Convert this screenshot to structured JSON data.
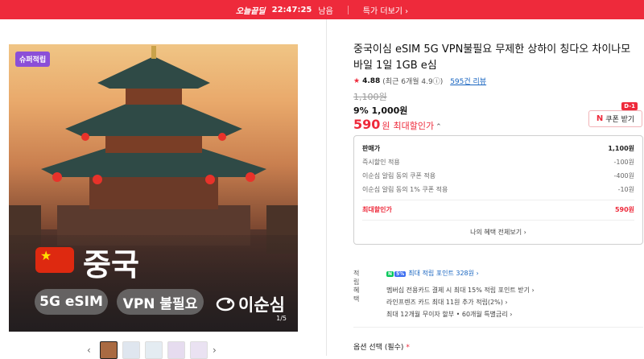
{
  "topbar": {
    "brand": "오늘끝딜",
    "timer": "22:47:25",
    "timer_suffix": "남음",
    "more": "특가 더보기 ›"
  },
  "hero": {
    "badge": "슈퍼적립",
    "country": "중국",
    "pill1": "5G eSIM",
    "pill2": "VPN 불필요",
    "logo": "이순심",
    "counter": "1/5"
  },
  "product": {
    "title": "중국이심 eSIM 5G VPN불필요 무제한 상하이 칭다오 차이나모바일 1일 1GB e심",
    "rating_score": "4.88",
    "rating_detail": "(최근 6개월 4.9ⓘ)",
    "review_link": "595건 리뷰",
    "original_price": "1,100원",
    "sale_price": "9% 1,000원",
    "final_num": "590",
    "final_unit": "원",
    "final_label": "최대할인가",
    "final_chev": "⌃"
  },
  "coupon": {
    "tag": "D-1",
    "icon": "N",
    "label": "쿠폰 받기"
  },
  "breakdown": {
    "head_label": "판매가",
    "head_value": "1,100원",
    "rows": [
      {
        "label": "즉시할인 적용",
        "value": "-100원"
      },
      {
        "label": "이순심 알림 동의 쿠폰 적용",
        "value": "-400원"
      },
      {
        "label": "이순심 알림 동의 1% 쿠폰 적용",
        "value": "-10원"
      }
    ],
    "max_label": "최대할인가",
    "max_value": "590원",
    "all_link": "나의 혜택 전체보기 ›"
  },
  "points": {
    "key": "적립",
    "npay": "N",
    "badge": "5%",
    "text": "최대 적립 포인트 328원 ›"
  },
  "benefits": {
    "key": "혜택",
    "lines": [
      "멤버십 전용카드 결제 시 최대 15% 적립 포인트 받기 ›",
      "라인프렌즈 카드 최대 11원 추가 적립(2%) ›",
      "최대 12개월 무이자 할부 • 60개월 특별금리 ›"
    ]
  },
  "option": {
    "label": "옵션 선택 (필수)",
    "req": "*"
  },
  "colors": {
    "accent": "#ee2a3b",
    "link": "#1764c0",
    "naver": "#03c75a"
  }
}
